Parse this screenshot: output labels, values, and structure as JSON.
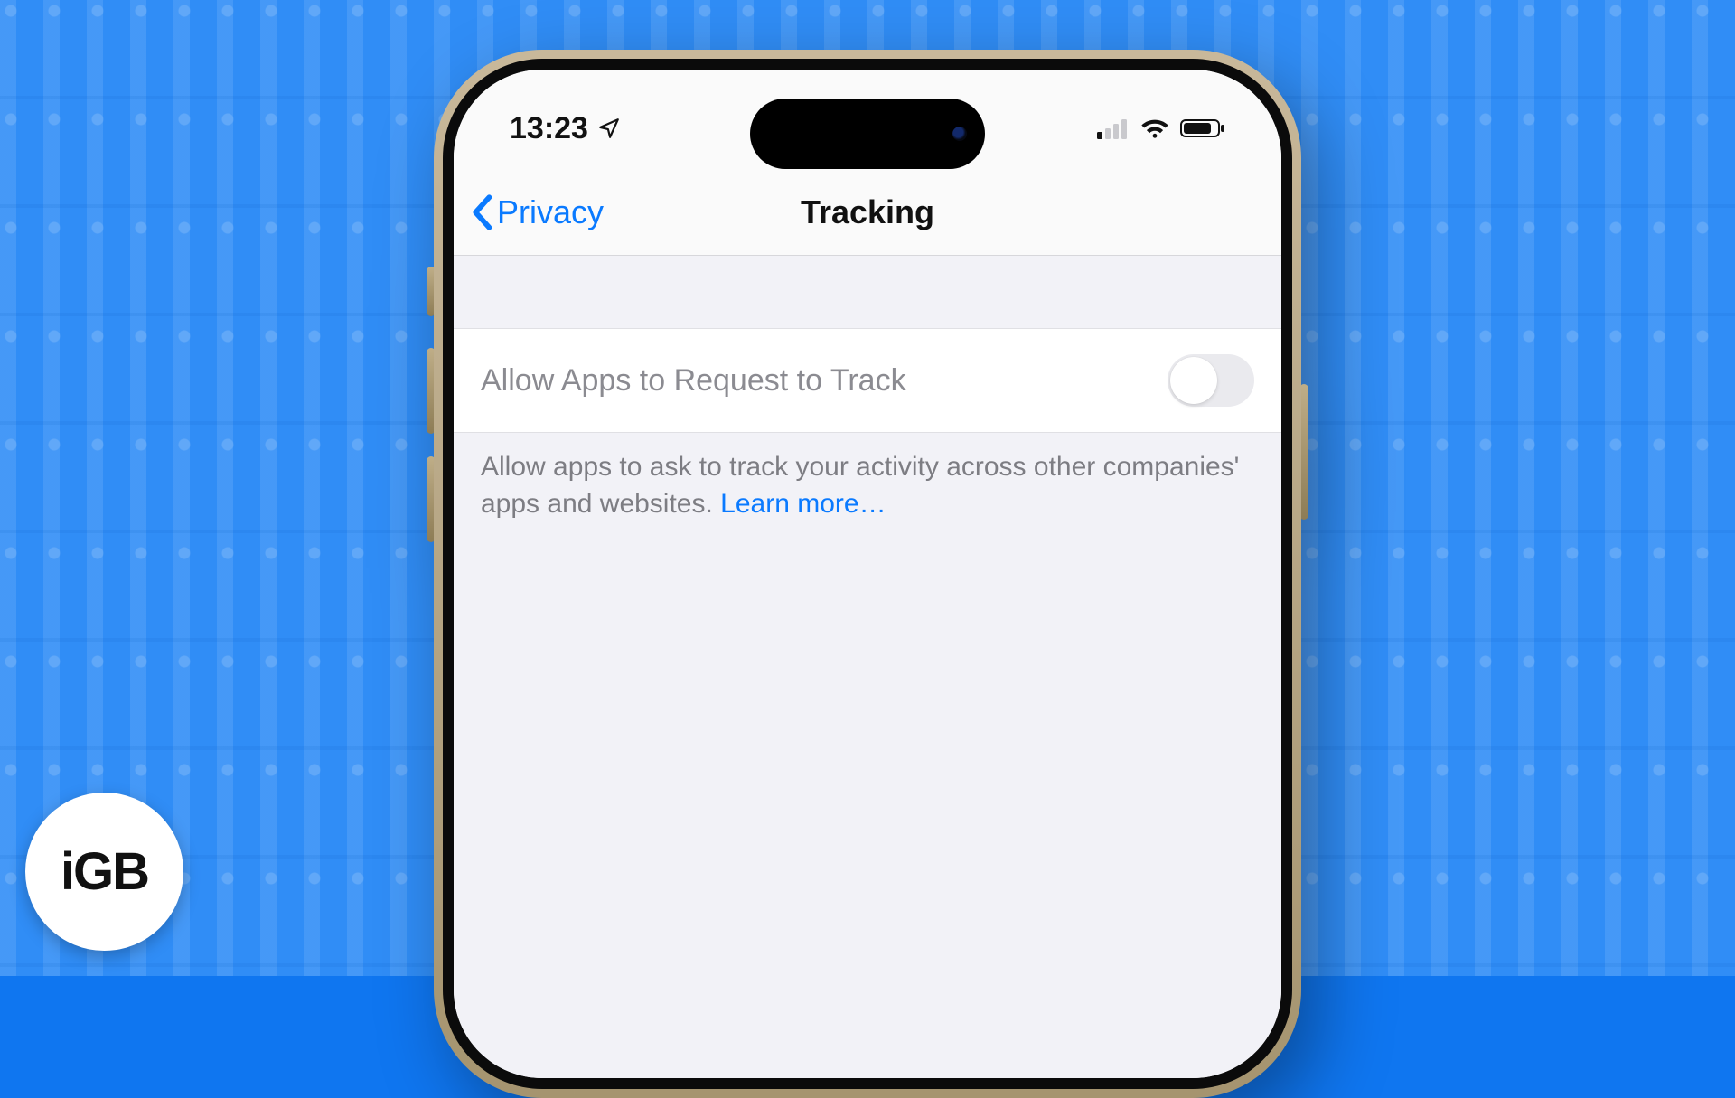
{
  "badge": {
    "label": "iGB"
  },
  "status": {
    "time": "13:23",
    "location_icon": "location-arrow-icon",
    "cellular_bars": 1,
    "wifi_icon": "wifi-icon",
    "battery_icon": "battery-icon"
  },
  "nav": {
    "back_label": "Privacy",
    "title": "Tracking"
  },
  "setting": {
    "label": "Allow Apps to Request to Track",
    "toggle_on": false,
    "toggle_enabled": false
  },
  "footer": {
    "text": "Allow apps to ask to track your activity across other companies' apps and websites. ",
    "link_label": "Learn more…"
  },
  "colors": {
    "ios_blue": "#0a7aff",
    "bg_blue": "#137df5",
    "settings_bg": "#f2f2f7"
  }
}
